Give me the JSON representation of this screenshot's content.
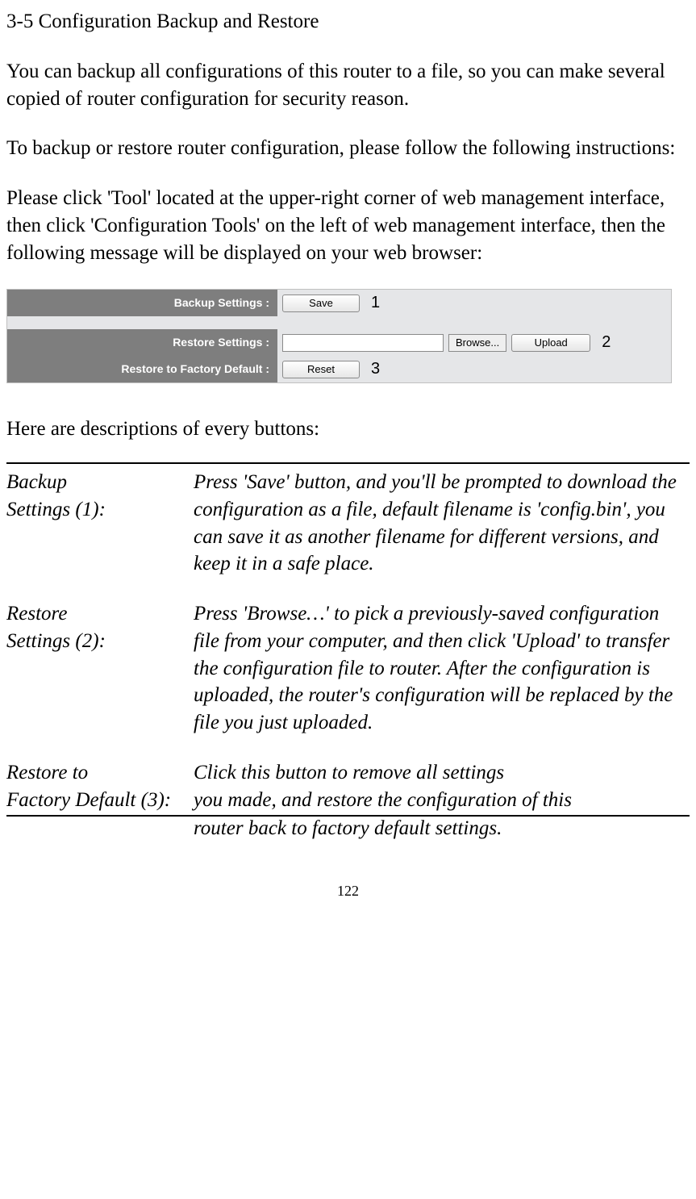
{
  "heading": "3-5 Configuration Backup and Restore",
  "para1": "You can backup all configurations of this router to a file, so you can make several copied of router configuration for security reason.",
  "para2": "To backup or restore router configuration, please follow the following instructions:",
  "para3": "Please click 'Tool' located at the upper-right corner of web management interface, then click 'Configuration Tools' on the left of web management interface, then the following message will be displayed on your web browser:",
  "panel": {
    "backup_label": "Backup Settings :",
    "save_btn": "Save",
    "anno1": "1",
    "restore_label": "Restore Settings :",
    "file_value": "",
    "browse_btn": "Browse...",
    "upload_btn": "Upload",
    "anno2": "2",
    "factory_label": "Restore to Factory Default :",
    "reset_btn": "Reset",
    "anno3": "3"
  },
  "desc_intro": "Here are descriptions of every buttons:",
  "desc": {
    "r1_label": "Backup\nSettings (1):",
    "r1_text": "Press 'Save' button, and you'll be prompted to download the configuration as a file, default filename is 'config.bin', you can save it as another filename for different versions, and keep it in a safe place.",
    "r2_label": "Restore\nSettings (2):",
    "r2_text": "Press 'Browse…' to pick a previously-saved configuration file from your computer, and then click 'Upload' to transfer the configuration file to router. After the configuration is uploaded, the router's configuration will be replaced by the file you just uploaded.",
    "r3_label": "Restore to\nFactory Default (3):",
    "r3_text_top": "Click this button to remove all settings\nyou made, and restore the configuration of this",
    "r3_text_overflow": "router back to factory default settings."
  },
  "page_num": "122"
}
